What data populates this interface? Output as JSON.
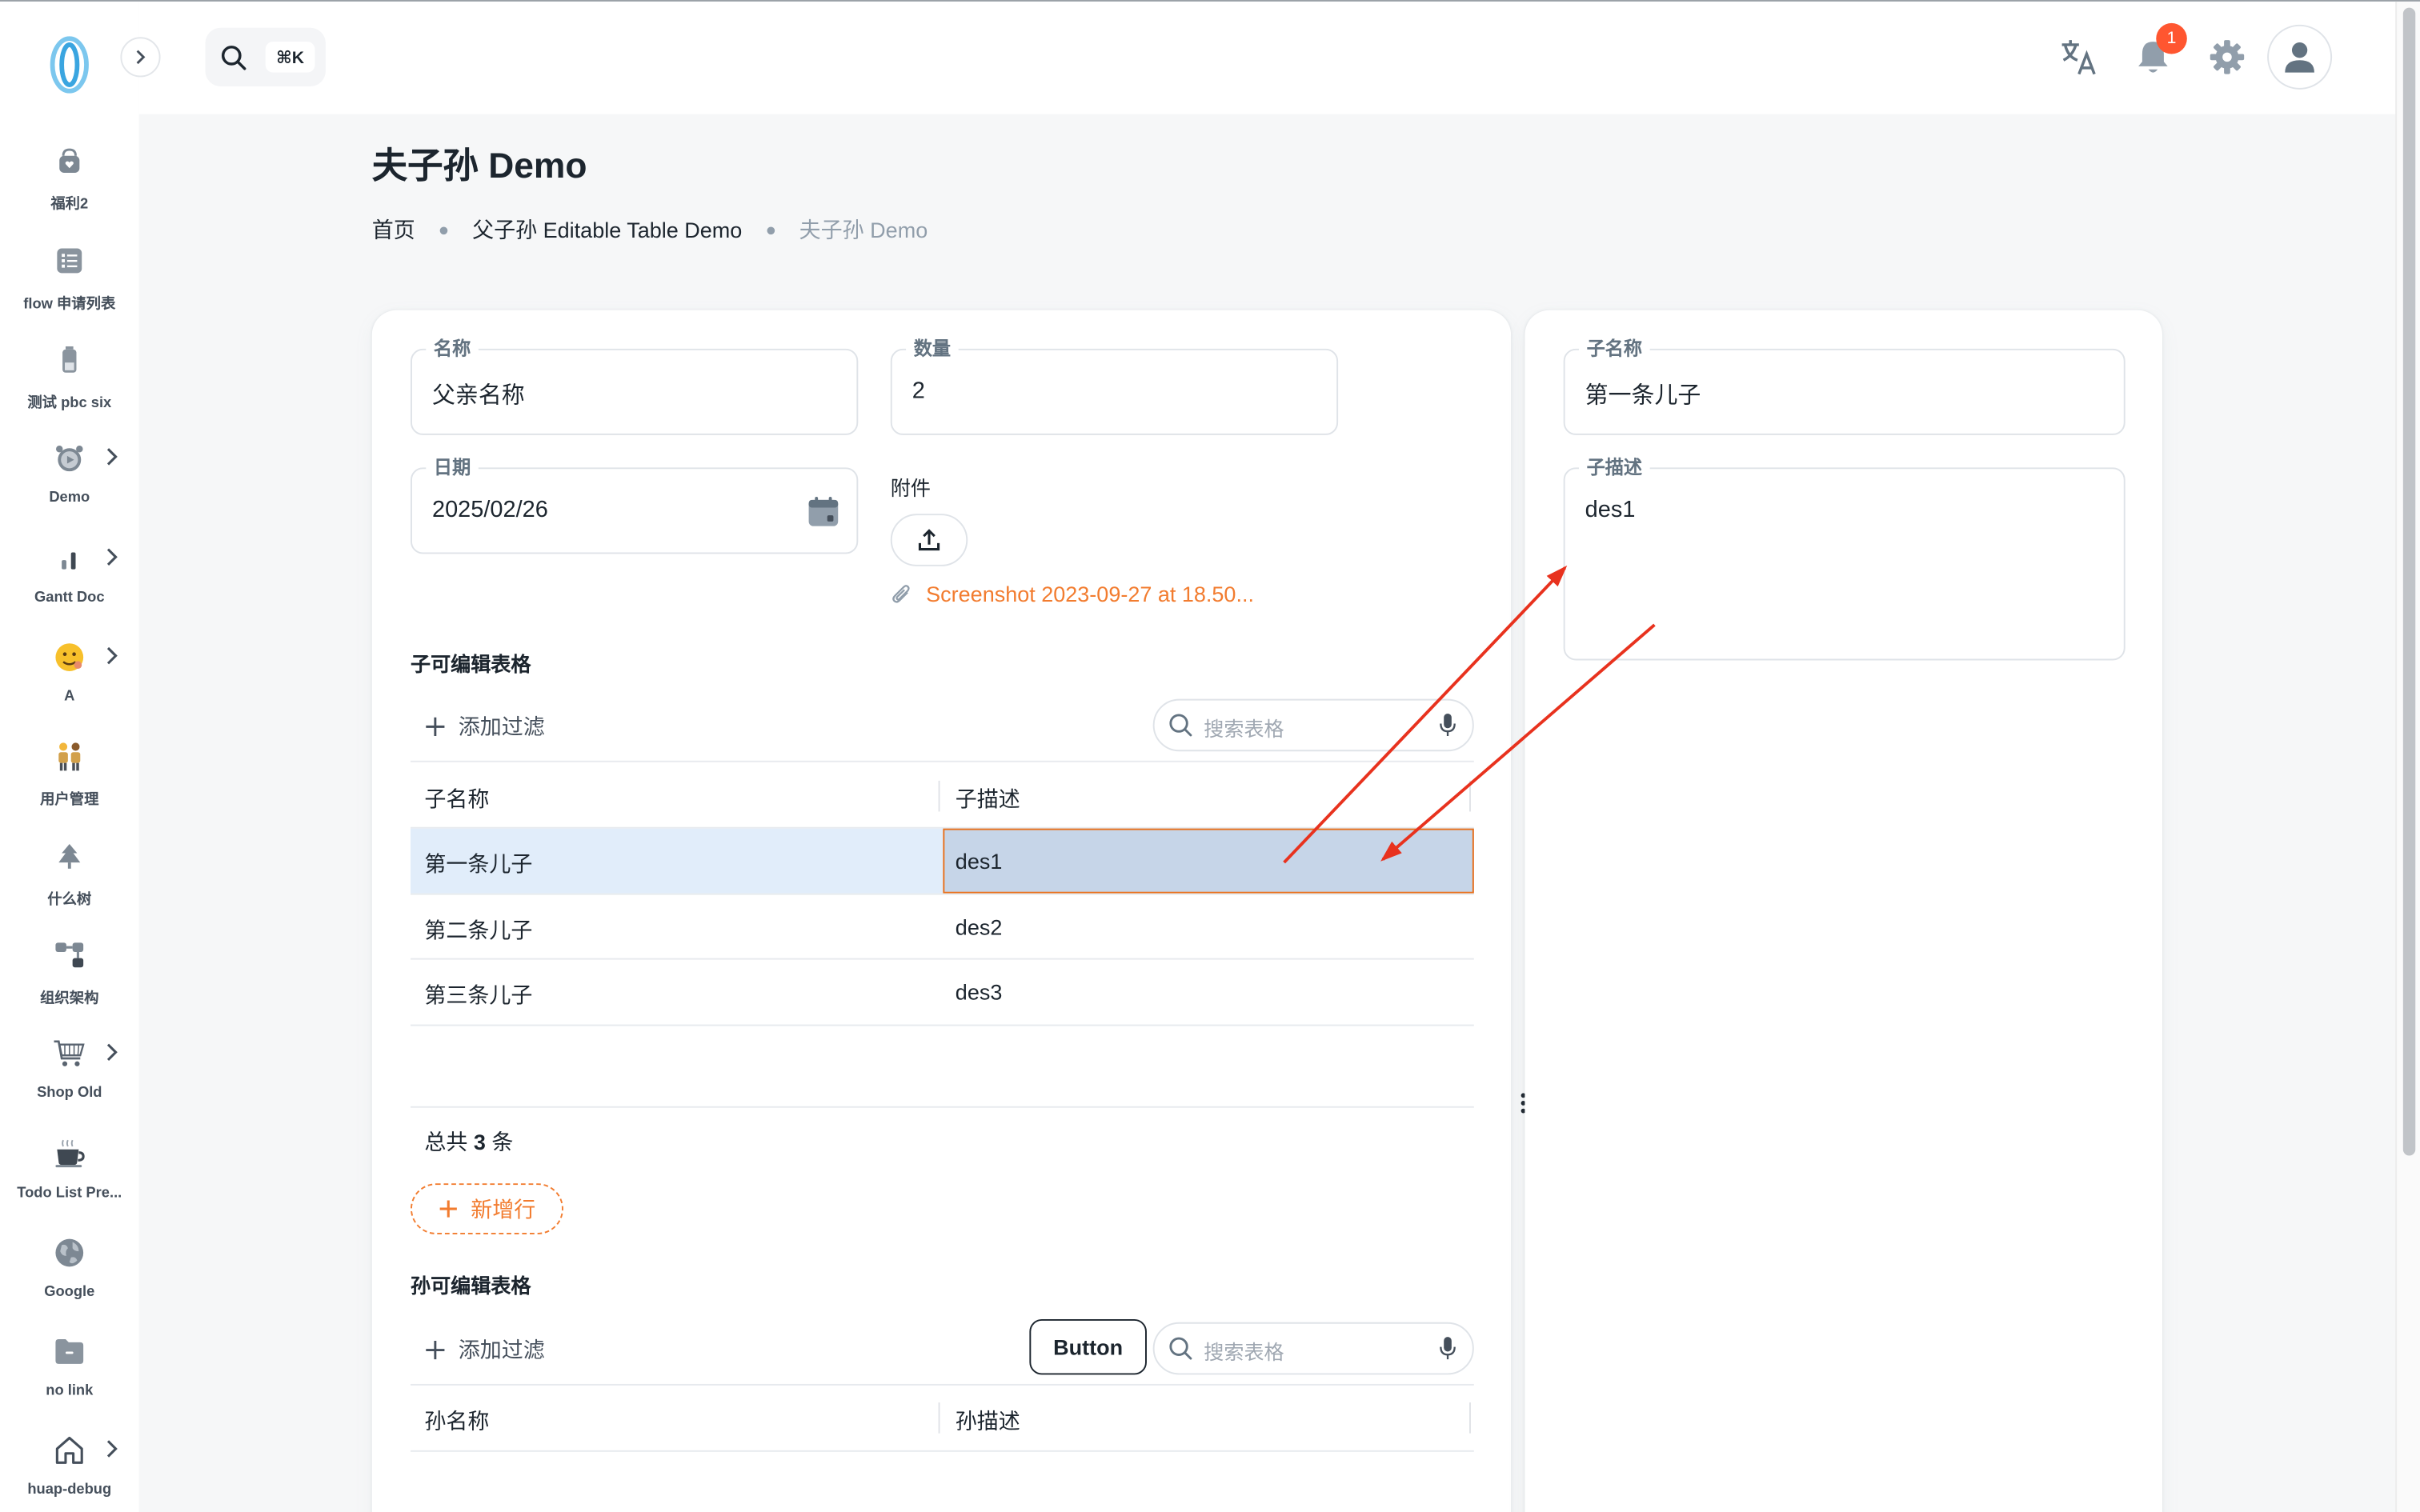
{
  "header": {
    "search_shortcut": "⌘K",
    "notification_count": "1"
  },
  "sidebar": {
    "items": [
      {
        "label": "福利2",
        "icon": "bag-icon"
      },
      {
        "label": "flow 申请列表",
        "icon": "list-icon"
      },
      {
        "label": "测试 pbc six",
        "icon": "battery-icon"
      },
      {
        "label": "Demo",
        "icon": "alarm-clock-icon"
      },
      {
        "label": "Gantt Doc",
        "icon": "bar-chart-icon"
      },
      {
        "label": "A",
        "icon": "emoji-face-icon"
      },
      {
        "label": "用户管理",
        "icon": "users-icon"
      },
      {
        "label": "什么树",
        "icon": "tree-icon"
      },
      {
        "label": "组织架构",
        "icon": "org-chart-icon"
      },
      {
        "label": "Shop Old",
        "icon": "shopping-cart-icon"
      },
      {
        "label": "Todo List Pre...",
        "icon": "coffee-icon"
      },
      {
        "label": "Google",
        "icon": "globe-icon"
      },
      {
        "label": "no link",
        "icon": "folder-icon"
      },
      {
        "label": "huap-debug",
        "icon": "home-icon"
      }
    ]
  },
  "page": {
    "title": "夫子孙 Demo",
    "breadcrumb": [
      "首页",
      "父子孙 Editable Table Demo",
      "夫子孙 Demo"
    ]
  },
  "form": {
    "name_label": "名称",
    "name_value": "父亲名称",
    "qty_label": "数量",
    "qty_value": "2",
    "date_label": "日期",
    "date_value": "2025/02/26",
    "attachment_label": "附件",
    "attachment_file": "Screenshot 2023-09-27 at 18.50..."
  },
  "child_table": {
    "title": "子可编辑表格",
    "add_filter": "添加过滤",
    "search_placeholder": "搜索表格",
    "columns": [
      "子名称",
      "子描述"
    ],
    "rows": [
      [
        "第一条儿子",
        "des1"
      ],
      [
        "第二条儿子",
        "des2"
      ],
      [
        "第三条儿子",
        "des3"
      ]
    ],
    "total_prefix": "总共",
    "total_count": "3",
    "total_suffix": "条",
    "add_row": "新增行"
  },
  "grandchild_table": {
    "title": "孙可编辑表格",
    "add_filter": "添加过滤",
    "button_label": "Button",
    "search_placeholder": "搜索表格",
    "columns": [
      "孙名称",
      "孙描述"
    ]
  },
  "detail": {
    "child_name_label": "子名称",
    "child_name_value": "第一条儿子",
    "child_desc_label": "子描述",
    "child_desc_value": "des1"
  },
  "colors": {
    "accent": "#f27c2f",
    "selection_row": "#e1edfa",
    "selection_cell": "#c6d5e8",
    "annotation_arrow": "#e8321e",
    "badge": "#ff5630"
  }
}
